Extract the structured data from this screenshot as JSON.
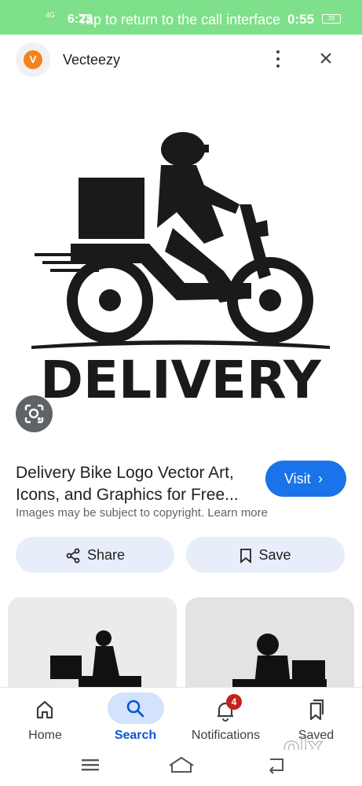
{
  "status_bar": {
    "network": "4G",
    "time": "6:23",
    "banner": "Tap to return to the call interface",
    "call_timer": "0:55",
    "battery": "39"
  },
  "header": {
    "site_logo_letter": "V",
    "site_name": "Vecteezy",
    "more_icon": "more-vert-icon",
    "close_icon": "close-icon"
  },
  "hero": {
    "logo_text": "DELIVERY"
  },
  "result": {
    "title": "Delivery Bike Logo Vector Art, Icons, and Graphics for Free...",
    "visit_label": "Visit",
    "copyright": "Images may be subject to copyright. Learn more"
  },
  "actions": {
    "share_label": "Share",
    "save_label": "Save"
  },
  "bottom_nav": {
    "items": [
      {
        "label": "Home",
        "icon": "home-icon"
      },
      {
        "label": "Search",
        "icon": "search-icon",
        "active": true
      },
      {
        "label": "Notifications",
        "icon": "bell-icon",
        "badge": "4"
      },
      {
        "label": "Saved",
        "icon": "saved-icon"
      }
    ]
  },
  "watermark": "olx",
  "colors": {
    "accent": "#1a73e8",
    "status_bar": "#7ee08a",
    "chip_bg": "#e8eef9",
    "badge": "#c5221f"
  }
}
